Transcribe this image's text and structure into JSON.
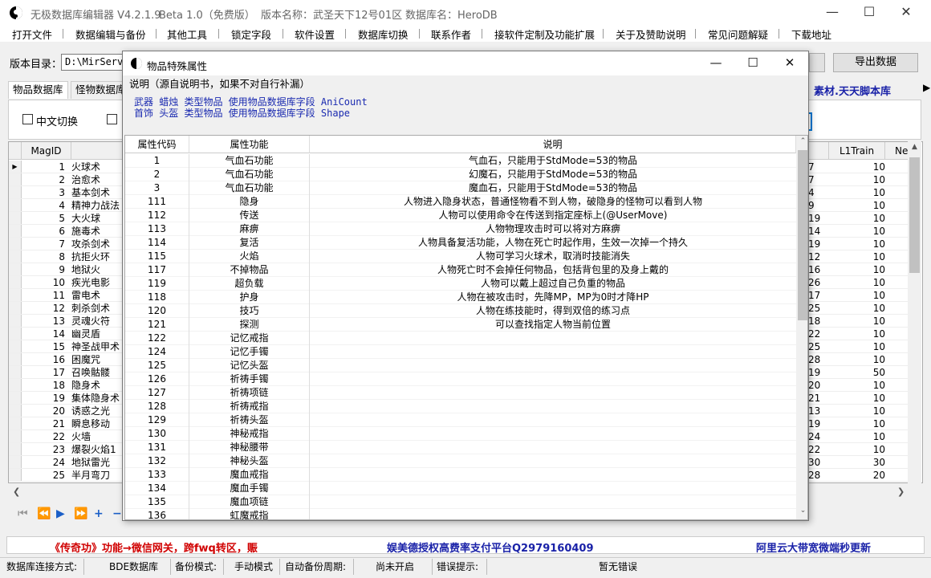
{
  "window": {
    "title_parts": [
      "无极数据库编辑器 V4.2.1.9",
      "Beta 1.0（免费版）",
      "版本名称：武圣天下12号01区",
      "数据库名：HeroDB"
    ]
  },
  "menu": [
    "打开文件",
    "数据编辑与备份",
    "其他工具",
    "锁定字段",
    "软件设置",
    "数据库切换",
    "联系作者",
    "接软件定制及功能扩展",
    "关于及赞助说明",
    "常见问题解疑",
    "下载地址"
  ],
  "version_row": {
    "label": "版本目录：",
    "path": "D:\\MirServ",
    "export_label": "导出数据"
  },
  "tabs": [
    "物品数据库",
    "怪物数据库"
  ],
  "brand_text": "素材.天天脚本库",
  "options": {
    "chinese_toggle": "中文切换"
  },
  "grid": {
    "headers": {
      "id": "MagID",
      "l1train": "L1Train",
      "next": "Ne"
    },
    "rows": [
      {
        "id": "1",
        "name": "火球术",
        "a": "7",
        "b": "10"
      },
      {
        "id": "2",
        "name": "治愈术",
        "a": "7",
        "b": "10"
      },
      {
        "id": "3",
        "name": "基本剑术",
        "a": "4",
        "b": "10"
      },
      {
        "id": "4",
        "name": "精神力战法",
        "a": "9",
        "b": "10"
      },
      {
        "id": "5",
        "name": "大火球",
        "a": "19",
        "b": "10"
      },
      {
        "id": "6",
        "name": "施毒术",
        "a": "14",
        "b": "10"
      },
      {
        "id": "7",
        "name": "攻杀剑术",
        "a": "19",
        "b": "10"
      },
      {
        "id": "8",
        "name": "抗拒火环",
        "a": "12",
        "b": "10"
      },
      {
        "id": "9",
        "name": "地狱火",
        "a": "16",
        "b": "10"
      },
      {
        "id": "10",
        "name": "疾光电影",
        "a": "26",
        "b": "10"
      },
      {
        "id": "11",
        "name": "雷电术",
        "a": "17",
        "b": "10"
      },
      {
        "id": "12",
        "name": "刺杀剑术",
        "a": "25",
        "b": "10"
      },
      {
        "id": "13",
        "name": "灵魂火符",
        "a": "18",
        "b": "10"
      },
      {
        "id": "14",
        "name": "幽灵盾",
        "a": "22",
        "b": "10"
      },
      {
        "id": "15",
        "name": "神圣战甲术",
        "a": "25",
        "b": "10"
      },
      {
        "id": "16",
        "name": "困魔咒",
        "a": "28",
        "b": "10"
      },
      {
        "id": "17",
        "name": "召唤骷髅",
        "a": "19",
        "b": "50"
      },
      {
        "id": "18",
        "name": "隐身术",
        "a": "20",
        "b": "10"
      },
      {
        "id": "19",
        "name": "集体隐身术",
        "a": "21",
        "b": "10"
      },
      {
        "id": "20",
        "name": "诱惑之光",
        "a": "13",
        "b": "10"
      },
      {
        "id": "21",
        "name": "瞬息移动",
        "a": "19",
        "b": "10"
      },
      {
        "id": "22",
        "name": "火墙",
        "a": "24",
        "b": "10"
      },
      {
        "id": "23",
        "name": "爆裂火焰1",
        "a": "22",
        "b": "10"
      },
      {
        "id": "24",
        "name": "地狱雷光",
        "a": "30",
        "b": "30"
      },
      {
        "id": "25",
        "name": "半月弯刀",
        "a": "28",
        "b": "20"
      }
    ]
  },
  "banner": {
    "left": "《传奇功》功能→微信网关，跨fwq转区，赈",
    "center": "娱美德授权高费率支付平台Q2979160409",
    "right": "阿里云大带宽微端秒更新"
  },
  "status": {
    "conn_label": "数据库连接方式:",
    "conn_value": "BDE数据库",
    "backup_label": "备份模式:",
    "backup_value": "手动模式",
    "auto_label": "自动备份周期:",
    "auto_value": "尚未开启",
    "err_label": "错误提示:",
    "err_value": "暂无错误"
  },
  "dialog": {
    "title": "物品特殊属性",
    "desc_heading": "说明（源自说明书，如果不对自行补漏）",
    "desc_line1": "武器 蜡烛 类型物品 使用物品数据库字段 AniCount",
    "desc_line2": "首饰 头盔 类型物品 使用物品数据库字段 Shape",
    "headers": {
      "code": "属性代码",
      "func": "属性功能",
      "desc": "说明"
    },
    "rows": [
      {
        "code": "1",
        "func": "气血石功能",
        "desc": "气血石，只能用于StdMode=53的物品"
      },
      {
        "code": "2",
        "func": "气血石功能",
        "desc": "幻魔石，只能用于StdMode=53的物品"
      },
      {
        "code": "3",
        "func": "气血石功能",
        "desc": "魔血石，只能用于StdMode=53的物品"
      },
      {
        "code": "111",
        "func": "隐身",
        "desc": "人物进入隐身状态，普通怪物看不到人物，破隐身的怪物可以看到人物"
      },
      {
        "code": "112",
        "func": "传送",
        "desc": "人物可以使用命令在传送到指定座标上(@UserMove)"
      },
      {
        "code": "113",
        "func": "麻痹",
        "desc": "人物物理攻击时可以将对方麻痹"
      },
      {
        "code": "114",
        "func": "复活",
        "desc": "人物具备复活功能，人物在死亡时起作用，生效一次掉一个持久"
      },
      {
        "code": "115",
        "func": "火焰",
        "desc": "人物可学习火球术，取消时技能消失"
      },
      {
        "code": "117",
        "func": "不掉物品",
        "desc": "人物死亡时不会掉任何物品，包括背包里的及身上戴的"
      },
      {
        "code": "119",
        "func": "超负载",
        "desc": "人物可以戴上超过自己负重的物品"
      },
      {
        "code": "118",
        "func": "护身",
        "desc": "人物在被攻击时，先降MP，MP为0时才降HP"
      },
      {
        "code": "120",
        "func": "技巧",
        "desc": "人物在练技能时，得到双倍的练习点"
      },
      {
        "code": "121",
        "func": "探测",
        "desc": "可以查找指定人物当前位置"
      },
      {
        "code": "122",
        "func": "记忆戒指",
        "desc": ""
      },
      {
        "code": "124",
        "func": "记忆手镯",
        "desc": ""
      },
      {
        "code": "125",
        "func": "记忆头盔",
        "desc": ""
      },
      {
        "code": "126",
        "func": "祈祷手镯",
        "desc": ""
      },
      {
        "code": "127",
        "func": "祈祷项链",
        "desc": ""
      },
      {
        "code": "128",
        "func": "祈祷戒指",
        "desc": ""
      },
      {
        "code": "129",
        "func": "祈祷头盔",
        "desc": ""
      },
      {
        "code": "130",
        "func": "神秘戒指",
        "desc": ""
      },
      {
        "code": "131",
        "func": "神秘腰带",
        "desc": ""
      },
      {
        "code": "132",
        "func": "神秘头盔",
        "desc": ""
      },
      {
        "code": "133",
        "func": "魔血戒指",
        "desc": ""
      },
      {
        "code": "134",
        "func": "魔血手镯",
        "desc": ""
      },
      {
        "code": "135",
        "func": "魔血项链",
        "desc": ""
      },
      {
        "code": "136",
        "func": "虹魔戒指",
        "desc": ""
      }
    ]
  }
}
